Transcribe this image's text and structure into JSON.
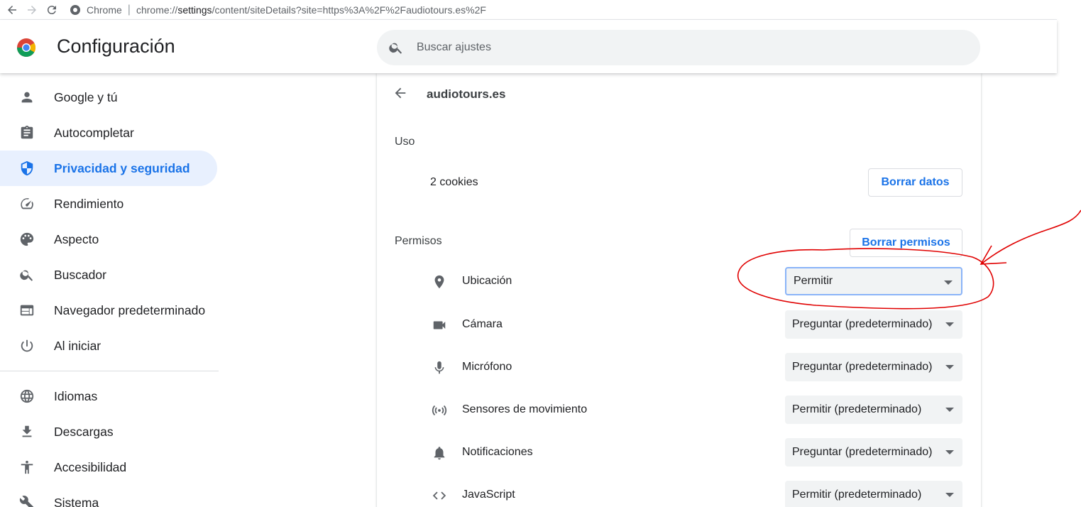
{
  "browser": {
    "origin_label": "Chrome",
    "url_prefix": "chrome://",
    "url_bold": "settings",
    "url_rest": "/content/siteDetails?site=https%3A%2F%2Faudiotours.es%2F"
  },
  "header": {
    "title": "Configuración",
    "search_placeholder": "Buscar ajustes"
  },
  "sidebar": {
    "items": [
      {
        "label": "Google y tú",
        "icon": "person-icon"
      },
      {
        "label": "Autocompletar",
        "icon": "clipboard-icon"
      },
      {
        "label": "Privacidad y seguridad",
        "icon": "shield-icon",
        "active": true
      },
      {
        "label": "Rendimiento",
        "icon": "speedometer-icon"
      },
      {
        "label": "Aspecto",
        "icon": "palette-icon"
      },
      {
        "label": "Buscador",
        "icon": "search-icon"
      },
      {
        "label": "Navegador predeterminado",
        "icon": "browser-window-icon"
      },
      {
        "label": "Al iniciar",
        "icon": "power-icon"
      },
      {
        "label": "Idiomas",
        "icon": "globe-icon"
      },
      {
        "label": "Descargas",
        "icon": "download-icon"
      },
      {
        "label": "Accesibilidad",
        "icon": "accessibility-icon"
      },
      {
        "label": "Sistema",
        "icon": "wrench-icon"
      }
    ]
  },
  "site": {
    "title": "audiotours.es",
    "usage_heading": "Uso",
    "cookies": "2 cookies",
    "clear_data_label": "Borrar datos",
    "permissions_heading": "Permisos",
    "reset_permissions_label": "Borrar permisos",
    "permissions": [
      {
        "label": "Ubicación",
        "value": "Permitir",
        "icon": "location-pin-icon"
      },
      {
        "label": "Cámara",
        "value": "Preguntar (predeterminado)",
        "icon": "camera-icon"
      },
      {
        "label": "Micrófono",
        "value": "Preguntar (predeterminado)",
        "icon": "microphone-icon"
      },
      {
        "label": "Sensores de movimiento",
        "value": "Permitir (predeterminado)",
        "icon": "motion-sensor-icon"
      },
      {
        "label": "Notificaciones",
        "value": "Preguntar (predeterminado)",
        "icon": "bell-icon"
      },
      {
        "label": "JavaScript",
        "value": "Permitir (predeterminado)",
        "icon": "code-icon"
      }
    ]
  },
  "colors": {
    "accent": "#1a73e8",
    "active_bg": "#e8f0fe",
    "annotation": "#e00000"
  }
}
